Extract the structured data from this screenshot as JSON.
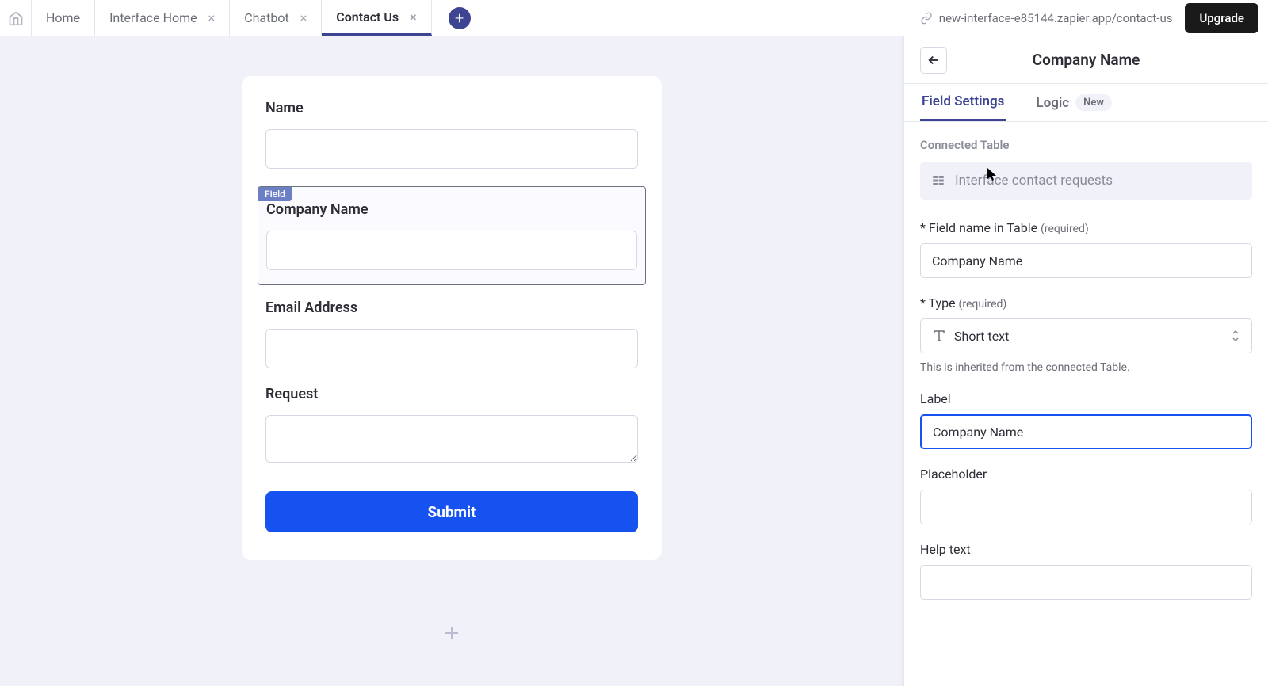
{
  "topbar": {
    "home": "Home",
    "tabs": [
      {
        "label": "Interface Home"
      },
      {
        "label": "Chatbot"
      },
      {
        "label": "Contact Us"
      }
    ],
    "url": "new-interface-e85144.zapier.app/contact-us",
    "upgrade": "Upgrade"
  },
  "form": {
    "field_badge": "Field",
    "fields": {
      "name": {
        "label": "Name"
      },
      "company_name": {
        "label": "Company Name"
      },
      "email": {
        "label": "Email Address"
      },
      "request": {
        "label": "Request"
      }
    },
    "submit": "Submit"
  },
  "panel": {
    "title": "Company Name",
    "tabs": {
      "field_settings": "Field Settings",
      "logic": "Logic",
      "new_badge": "New"
    },
    "connected_table": {
      "label": "Connected Table",
      "value": "Interface contact requests"
    },
    "field_name": {
      "label": "Field name in Table",
      "required": "(required)",
      "value": "Company Name"
    },
    "type": {
      "label": "Type",
      "required": "(required)",
      "value": "Short text",
      "help": "This is inherited from the connected Table."
    },
    "label_field": {
      "label": "Label",
      "value": "Company Name"
    },
    "placeholder": {
      "label": "Placeholder",
      "value": ""
    },
    "help_text": {
      "label": "Help text",
      "value": ""
    }
  }
}
